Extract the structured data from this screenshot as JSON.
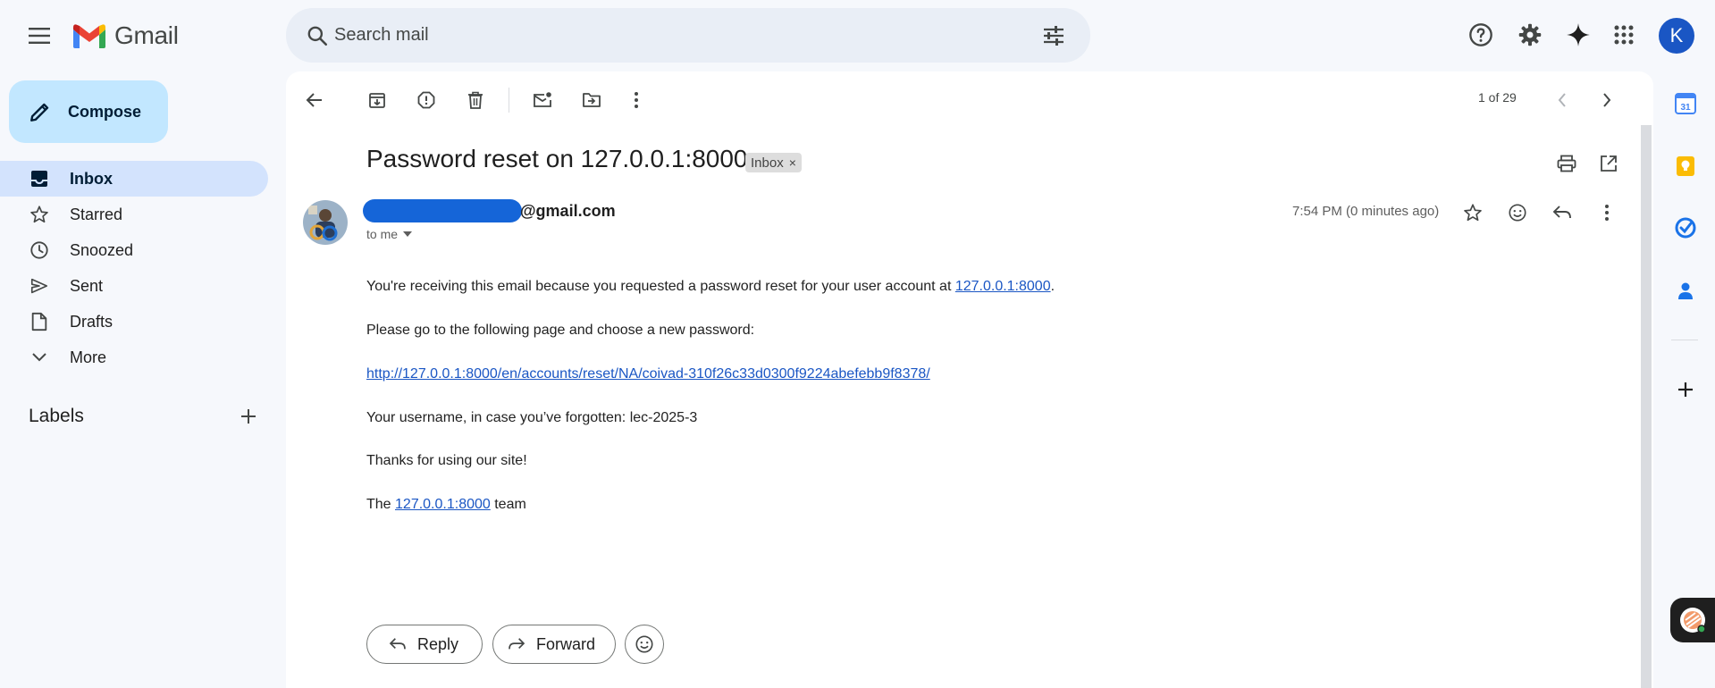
{
  "header": {
    "app_name": "Gmail",
    "search_placeholder": "Search mail",
    "avatar_letter": "K"
  },
  "nav": {
    "compose_label": "Compose",
    "items": [
      {
        "label": "Inbox",
        "icon": "inbox-icon",
        "active": true
      },
      {
        "label": "Starred",
        "icon": "star-icon"
      },
      {
        "label": "Snoozed",
        "icon": "clock-icon"
      },
      {
        "label": "Sent",
        "icon": "send-icon"
      },
      {
        "label": "Drafts",
        "icon": "draft-icon"
      },
      {
        "label": "More",
        "icon": "chevron-down-icon"
      }
    ],
    "labels_title": "Labels"
  },
  "toolbar": {
    "pager": "1 of 29"
  },
  "message": {
    "subject": "Password reset on 127.0.0.1:8000",
    "label_chip": "Inbox",
    "label_chip_close": "×",
    "sender_email": "@gmail.com",
    "to_line": "to me",
    "time": "7:54 PM (0 minutes ago)",
    "body": {
      "line1_text": "You're receiving this email because you requested a password reset for your user account at ",
      "line1_link": "127.0.0.1:8000",
      "line1_end": ".",
      "line2": "Please go to the following page and choose a new password:",
      "reset_link": "http://127.0.0.1:8000/en/accounts/reset/NA/coivad-310f26c33d0300f9224abefebb9f8378/",
      "line4": "Your username, in case you’ve forgotten: lec-2025-3",
      "line5": "Thanks for using our site!",
      "line6_start": "The ",
      "line6_link": "127.0.0.1:8000",
      "line6_end": " team"
    },
    "reply_label": "Reply",
    "forward_label": "Forward"
  },
  "side_panel": {
    "calendar_day": "31"
  },
  "colors": {
    "background": "#f6f8fc",
    "compose": "#c2e7ff",
    "active_nav": "#d3e3fd",
    "link": "#1a56c4",
    "avatar": "#1a56c4"
  }
}
